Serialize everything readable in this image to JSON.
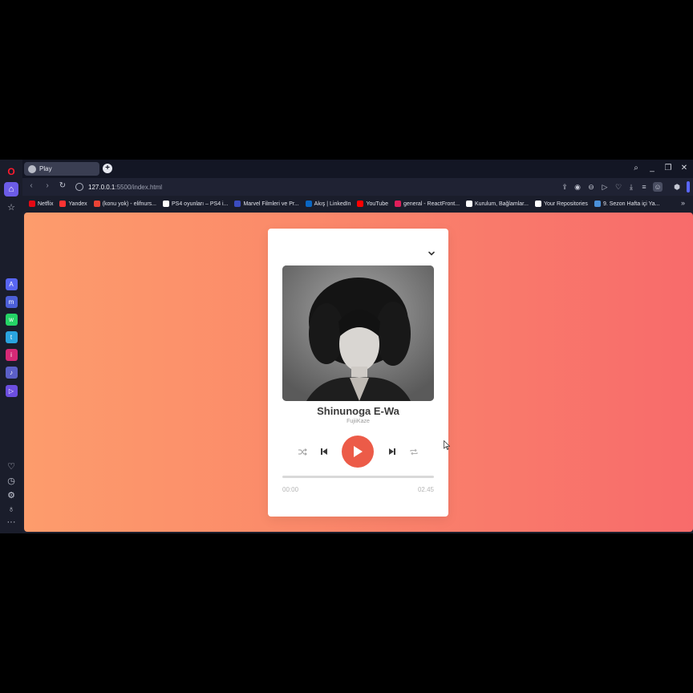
{
  "browser": {
    "tab": {
      "title": "Play"
    },
    "address": {
      "url_host": "127.0.0.1",
      "url_path": ":5500/index.html"
    },
    "bookmarks": [
      {
        "label": "Netflix",
        "color": "#e50914"
      },
      {
        "label": "Yandex",
        "color": "#ff3333"
      },
      {
        "label": "(konu yok) - elifnurs...",
        "color": "#ea4335"
      },
      {
        "label": "PS4 oyunları – PS4 i...",
        "color": "#ffffff"
      },
      {
        "label": "Marvel Filmleri ve Pr...",
        "color": "#3b4cc0"
      },
      {
        "label": "Akış | LinkedIn",
        "color": "#0a66c2"
      },
      {
        "label": "YouTube",
        "color": "#ff0000"
      },
      {
        "label": "general - ReactFront...",
        "color": "#e01e5a"
      },
      {
        "label": "Kurulum, Bağlamlar...",
        "color": "#ffffff"
      },
      {
        "label": "Your Repositories",
        "color": "#ffffff"
      },
      {
        "label": "9. Sezon Hafta içi Ya...",
        "color": "#4a90d9"
      }
    ]
  },
  "player": {
    "title": "Shinunoga E-Wa",
    "artist": "FujiiKaze",
    "current_time": "00:00",
    "duration": "02.45",
    "progress": 0,
    "accent_color": "#ec5b48"
  },
  "colors": {
    "gradient_start": "#fd9c6c",
    "gradient_end": "#f86b6b"
  }
}
